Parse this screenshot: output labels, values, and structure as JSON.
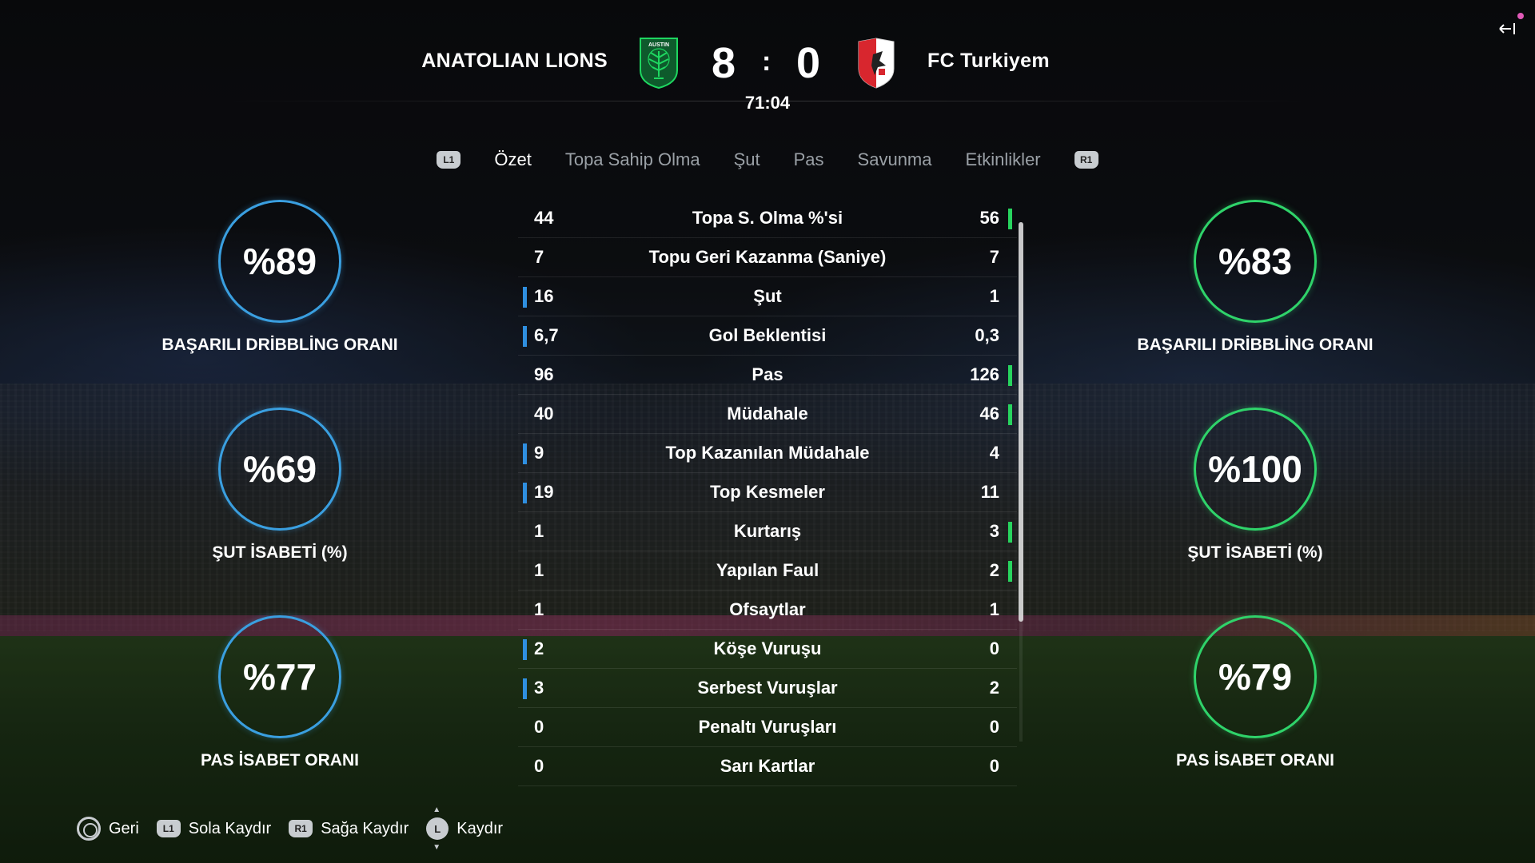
{
  "header": {
    "home_team": "ANATOLIAN LIONS",
    "away_team": "FC Turkiyem",
    "home_score": "8",
    "score_separator": ":",
    "away_score": "0",
    "clock": "71:04",
    "home_crest_text": "AUSTIN"
  },
  "tabs": {
    "left_bumper": "L1",
    "right_bumper": "R1",
    "items": [
      "Özet",
      "Topa Sahip Olma",
      "Şut",
      "Pas",
      "Savunma",
      "Etkinlikler"
    ],
    "active": "Özet"
  },
  "stats": [
    {
      "label": "Topa S. Olma %'si",
      "home": "44",
      "away": "56",
      "lead": "away"
    },
    {
      "label": "Topu Geri Kazanma (Saniye)",
      "home": "7",
      "away": "7",
      "lead": "none"
    },
    {
      "label": "Şut",
      "home": "16",
      "away": "1",
      "lead": "home"
    },
    {
      "label": "Gol Beklentisi",
      "home": "6,7",
      "away": "0,3",
      "lead": "home"
    },
    {
      "label": "Pas",
      "home": "96",
      "away": "126",
      "lead": "away"
    },
    {
      "label": "Müdahale",
      "home": "40",
      "away": "46",
      "lead": "away"
    },
    {
      "label": "Top Kazanılan Müdahale",
      "home": "9",
      "away": "4",
      "lead": "home"
    },
    {
      "label": "Top Kesmeler",
      "home": "19",
      "away": "11",
      "lead": "home"
    },
    {
      "label": "Kurtarış",
      "home": "1",
      "away": "3",
      "lead": "away"
    },
    {
      "label": "Yapılan Faul",
      "home": "1",
      "away": "2",
      "lead": "away"
    },
    {
      "label": "Ofsaytlar",
      "home": "1",
      "away": "1",
      "lead": "none"
    },
    {
      "label": "Köşe Vuruşu",
      "home": "2",
      "away": "0",
      "lead": "home"
    },
    {
      "label": "Serbest Vuruşlar",
      "home": "3",
      "away": "2",
      "lead": "home"
    },
    {
      "label": "Penaltı Vuruşları",
      "home": "0",
      "away": "0",
      "lead": "none"
    },
    {
      "label": "Sarı Kartlar",
      "home": "0",
      "away": "0",
      "lead": "none"
    }
  ],
  "home_rings": [
    {
      "value": "%89",
      "label": "BAŞARILI DRİBBLİNG ORANI"
    },
    {
      "value": "%69",
      "label": "ŞUT İSABETİ (%)"
    },
    {
      "value": "%77",
      "label": "PAS İSABET ORANI"
    }
  ],
  "away_rings": [
    {
      "value": "%83",
      "label": "BAŞARILI DRİBBLİNG ORANI"
    },
    {
      "value": "%100",
      "label": "ŞUT İSABETİ (%)"
    },
    {
      "value": "%79",
      "label": "PAS İSABET ORANI"
    }
  ],
  "footer": {
    "back": "Geri",
    "l1_glyph": "L1",
    "scroll_left": "Sola Kaydır",
    "r1_glyph": "R1",
    "scroll_right": "Sağa Kaydır",
    "stick_glyph": "L",
    "scroll": "Kaydır"
  },
  "colors": {
    "home_accent": "#2f8fe0",
    "away_accent": "#27d45e"
  }
}
